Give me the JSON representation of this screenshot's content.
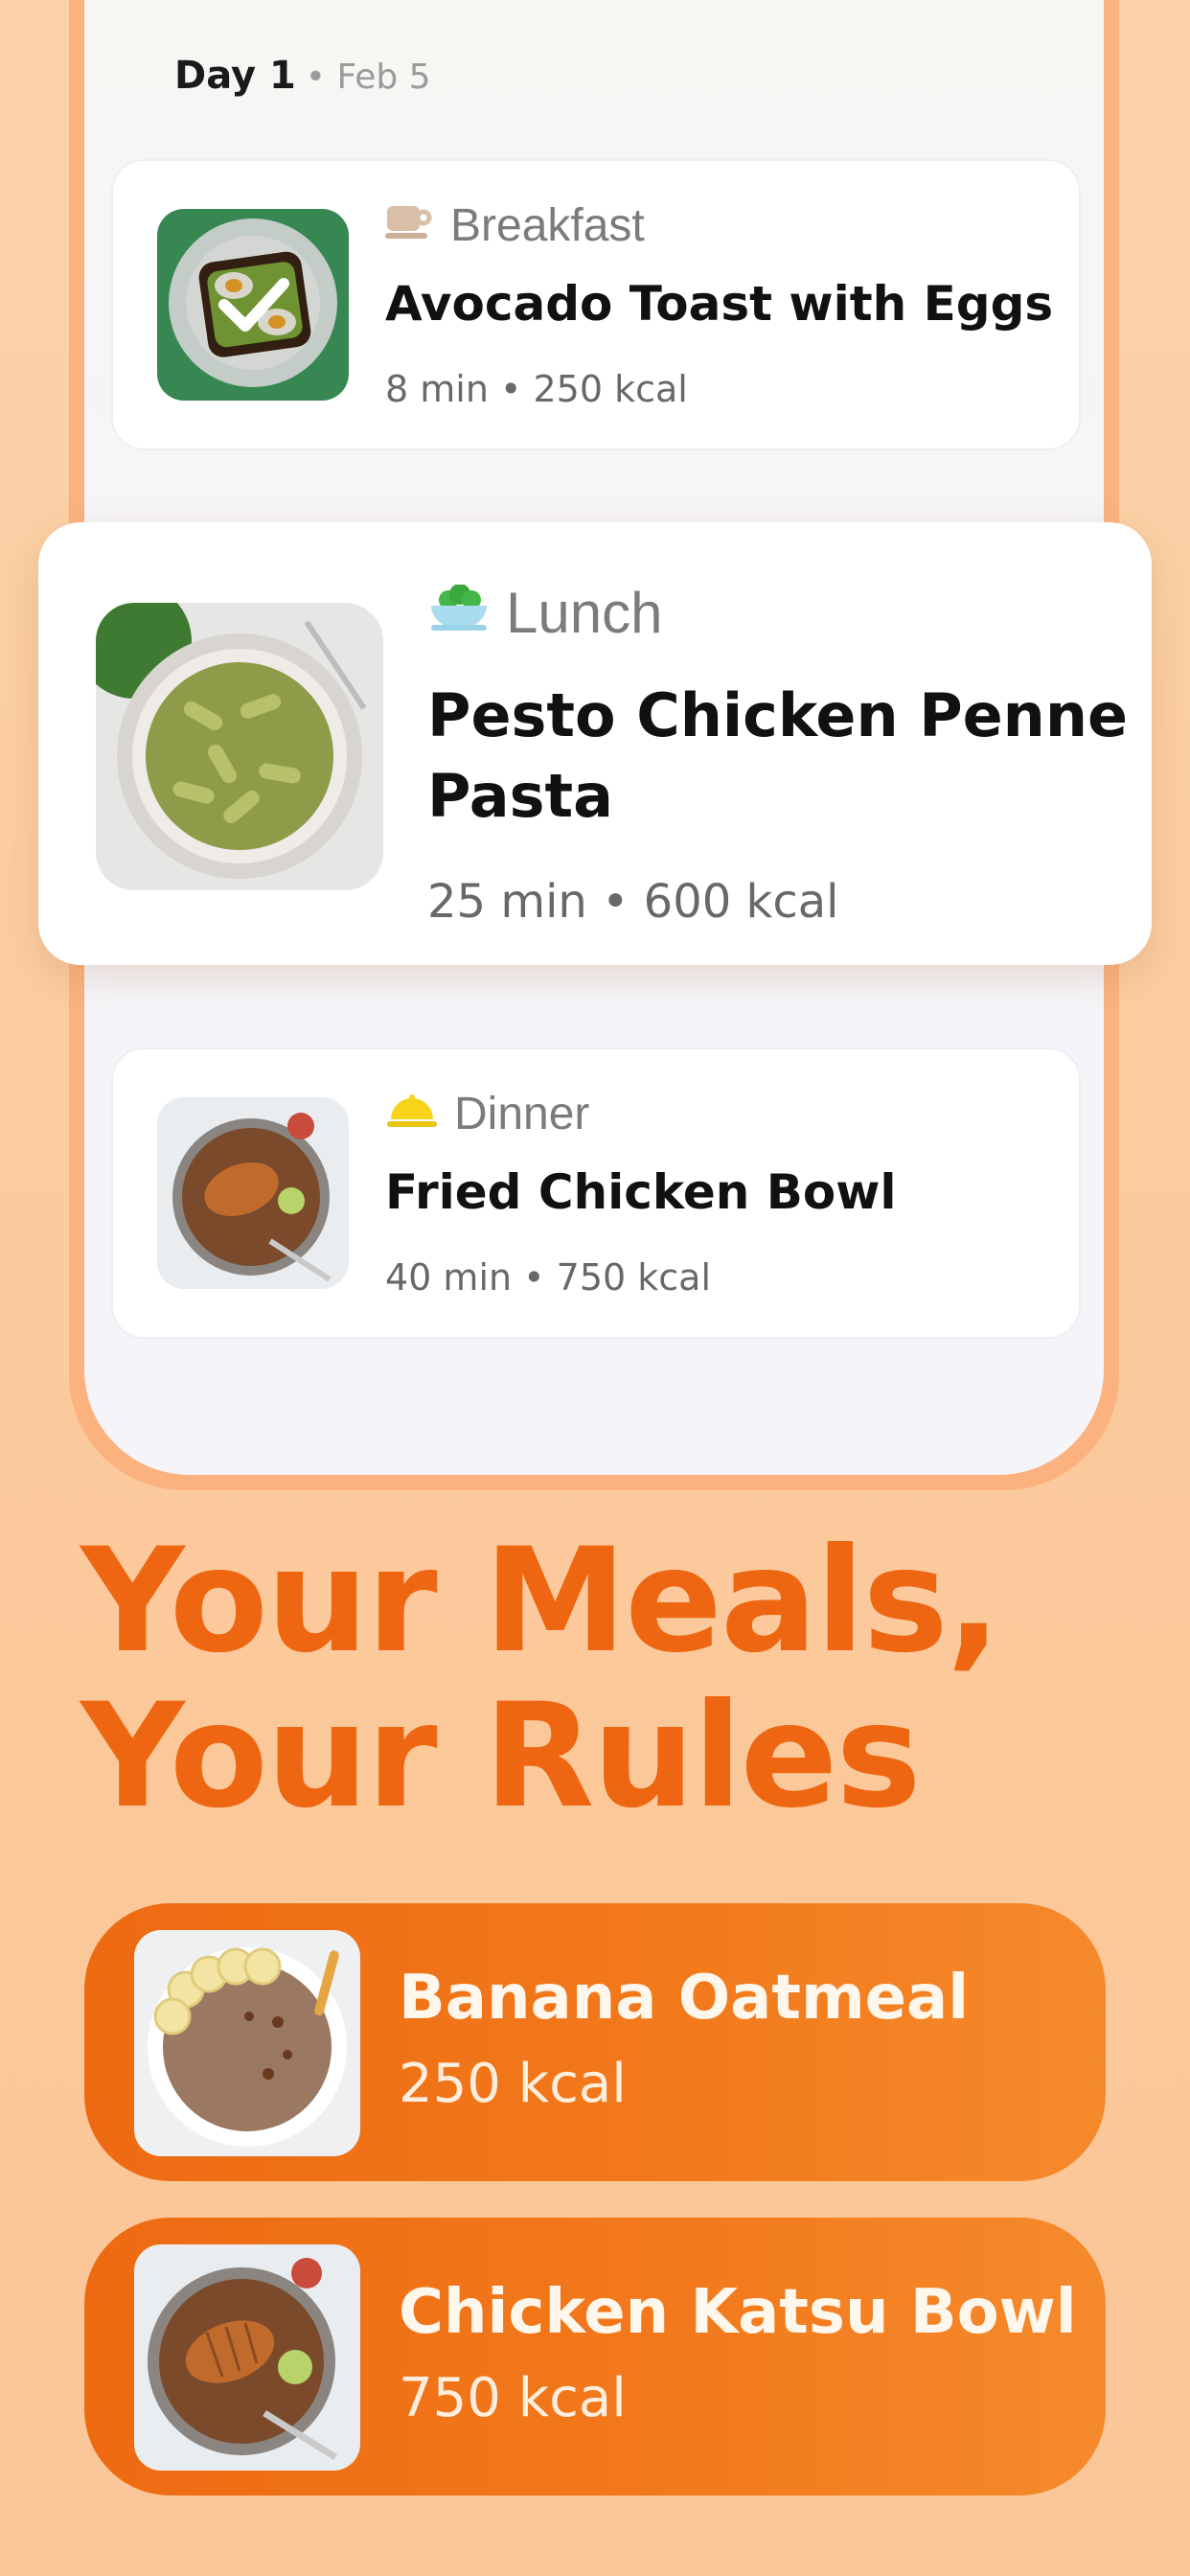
{
  "day": {
    "title": "Day 1",
    "date": "• Feb 5"
  },
  "meals": [
    {
      "type": "Breakfast",
      "type_icon": "coffee-cup-icon",
      "name": "Avocado Toast with Eggs",
      "meta": "8 min • 250 kcal",
      "image": "avocado-toast-photo",
      "completed": true
    },
    {
      "type": "Lunch",
      "type_icon": "salad-bowl-icon",
      "name": "Pesto Chicken Penne Pasta",
      "meta": "25 min • 600 kcal",
      "image": "pesto-pasta-photo"
    },
    {
      "type": "Dinner",
      "type_icon": "cloche-icon",
      "name": "Fried Chicken Bowl",
      "meta": "40 min • 750 kcal",
      "image": "fried-chicken-bowl-photo"
    }
  ],
  "headline": {
    "line1": "Your Meals,",
    "line2": "Your Rules"
  },
  "rules": [
    {
      "name": "Banana Oatmeal",
      "kcal": "250 kcal",
      "image": "banana-oatmeal-photo"
    },
    {
      "name": "Chicken Katsu Bowl",
      "kcal": "750 kcal",
      "image": "chicken-katsu-bowl-photo"
    }
  ],
  "colors": {
    "accent": "#ee6611",
    "card_gradient_start": "#ee6a12",
    "card_gradient_end": "#f58a2c",
    "background": "#fcd3ab"
  }
}
